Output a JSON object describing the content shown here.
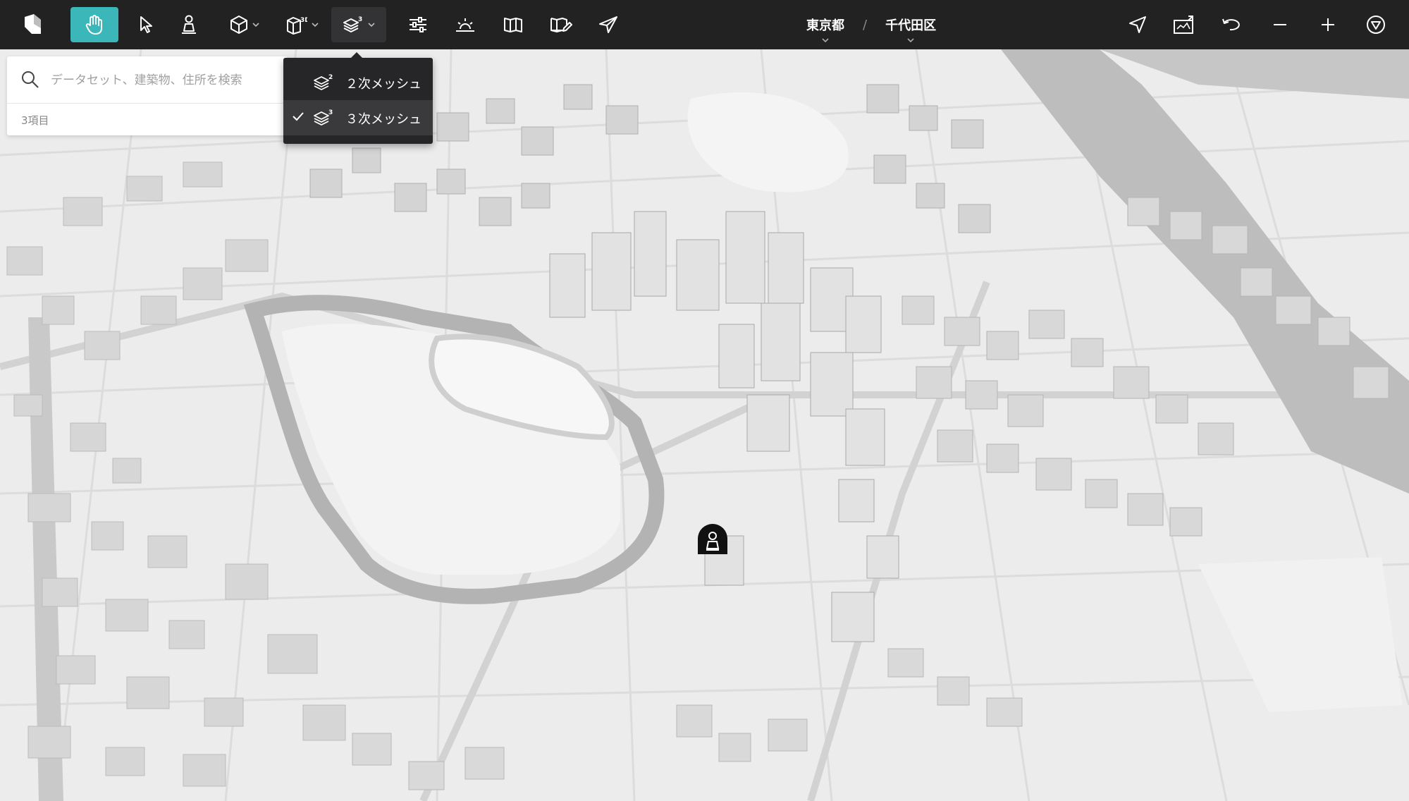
{
  "breadcrumb": {
    "prefecture": "東京都",
    "separator": "/",
    "ward": "千代田区"
  },
  "toolbar": {
    "left_tools": [
      "app-logo-icon",
      "hand-pan-icon",
      "pointer-select-icon",
      "pedestrian-icon",
      "cube-icon",
      "building-3d-icon",
      "mesh-layers-icon"
    ],
    "middle_tools": [
      "sliders-icon",
      "sunrise-icon",
      "map-book-icon",
      "map-edit-icon",
      "send-arrow-icon"
    ],
    "right_tools": [
      "navigation-arrow-icon",
      "screenshot-icon",
      "undo-icon",
      "zoom-out-icon",
      "zoom-in-icon",
      "compass-icon"
    ],
    "active_tool": "hand-pan-icon"
  },
  "search": {
    "placeholder": "データセット、建築物、住所を検索",
    "value": "",
    "result_count": "3項目"
  },
  "mesh_menu": {
    "items": [
      {
        "label": "２次メッシュ",
        "icon": "mesh-2-icon",
        "selected": false
      },
      {
        "label": "３次メッシュ",
        "icon": "mesh-3-icon",
        "selected": true
      }
    ]
  },
  "colors": {
    "toolbar_bg": "#222223",
    "accent": "#3bb7b9",
    "dropdown_bg": "#262628",
    "map_bg": "#ededed",
    "water": "#b8b8b8"
  }
}
